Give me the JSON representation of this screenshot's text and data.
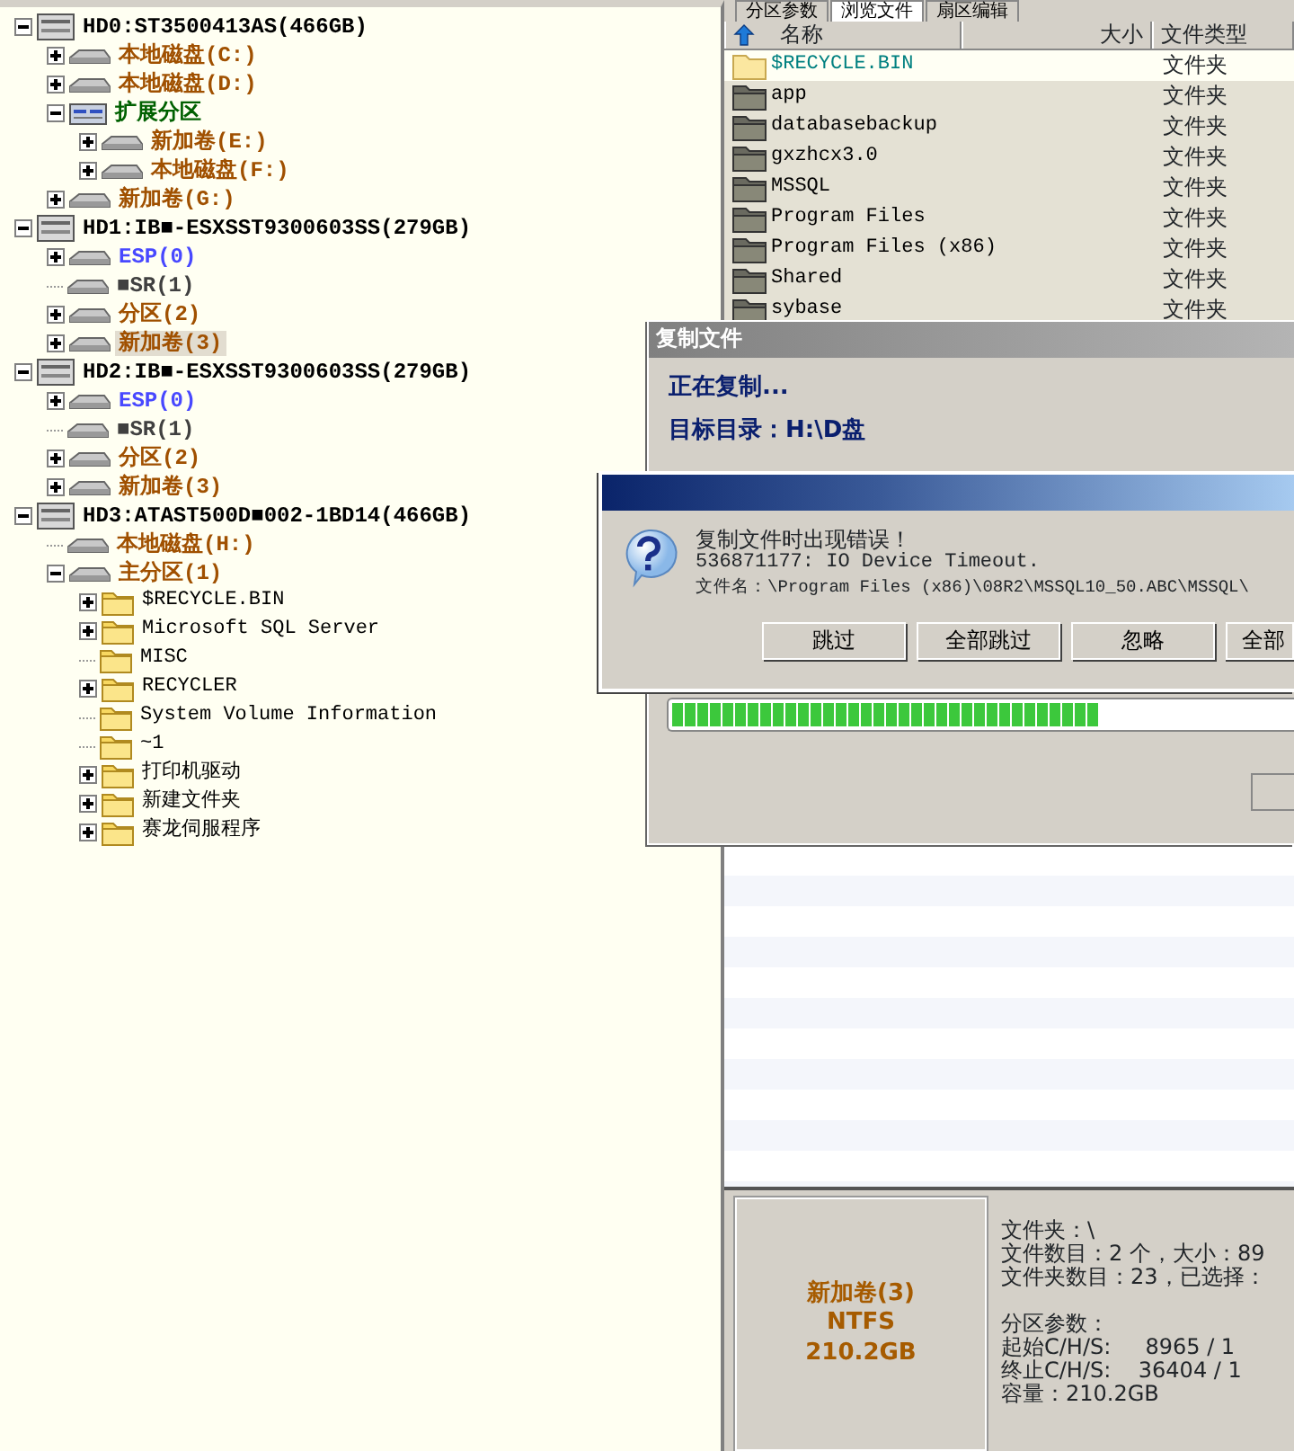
{
  "tree": [
    {
      "label": "HD0:ST3500413AS(466GB)",
      "kind": "disk",
      "expandable": true,
      "expanded": true,
      "selected": false,
      "color": "#000000",
      "children": [
        {
          "label": "本地磁盘(C:)",
          "kind": "partition",
          "expandable": true,
          "expanded": false,
          "selected": false,
          "color": "#a05000"
        },
        {
          "label": "本地磁盘(D:)",
          "kind": "partition",
          "expandable": true,
          "expanded": false,
          "selected": false,
          "color": "#a05000"
        },
        {
          "label": "扩展分区",
          "kind": "extended",
          "expandable": true,
          "expanded": true,
          "selected": false,
          "color": "#006000",
          "children": [
            {
              "label": "新加卷(E:)",
              "kind": "partition",
              "expandable": true,
              "expanded": false,
              "selected": false,
              "color": "#a05000"
            },
            {
              "label": "本地磁盘(F:)",
              "kind": "partition",
              "expandable": true,
              "expanded": false,
              "selected": false,
              "color": "#a05000"
            }
          ]
        },
        {
          "label": "新加卷(G:)",
          "kind": "partition",
          "expandable": true,
          "expanded": false,
          "selected": false,
          "color": "#a05000"
        }
      ]
    },
    {
      "label": "HD1:IB■-ESXSST9300603SS(279GB)",
      "kind": "disk",
      "expandable": true,
      "expanded": true,
      "selected": false,
      "color": "#000000",
      "children": [
        {
          "label": "ESP(0)",
          "kind": "partition",
          "expandable": true,
          "expanded": false,
          "selected": false,
          "color": "#4848ff"
        },
        {
          "label": "■SR(1)",
          "kind": "partition",
          "expandable": false,
          "selected": false,
          "color": "#404040"
        },
        {
          "label": "分区(2)",
          "kind": "partition",
          "expandable": true,
          "expanded": false,
          "selected": false,
          "color": "#a05000"
        },
        {
          "label": "新加卷(3)",
          "kind": "partition",
          "expandable": true,
          "expanded": false,
          "selected": true,
          "color": "#a05000"
        }
      ]
    },
    {
      "label": "HD2:IB■-ESXSST9300603SS(279GB)",
      "kind": "disk",
      "expandable": true,
      "expanded": true,
      "selected": false,
      "color": "#000000",
      "children": [
        {
          "label": "ESP(0)",
          "kind": "partition",
          "expandable": true,
          "expanded": false,
          "selected": false,
          "color": "#4848ff"
        },
        {
          "label": "■SR(1)",
          "kind": "partition",
          "expandable": false,
          "selected": false,
          "color": "#404040"
        },
        {
          "label": "分区(2)",
          "kind": "partition",
          "expandable": true,
          "expanded": false,
          "selected": false,
          "color": "#a05000"
        },
        {
          "label": "新加卷(3)",
          "kind": "partition",
          "expandable": true,
          "expanded": false,
          "selected": false,
          "color": "#a05000"
        }
      ]
    },
    {
      "label": "HD3:ATAST500D■002-1BD14(466GB)",
      "kind": "disk",
      "expandable": true,
      "expanded": true,
      "selected": false,
      "color": "#000000",
      "children": [
        {
          "label": "本地磁盘(H:)",
          "kind": "partition",
          "expandable": false,
          "selected": false,
          "color": "#a05000"
        },
        {
          "label": "主分区(1)",
          "kind": "partition",
          "expandable": true,
          "expanded": true,
          "selected": false,
          "color": "#a05000",
          "children": [
            {
              "label": "$RECYCLE.BIN",
              "kind": "folder",
              "expandable": true,
              "expanded": false,
              "selected": false,
              "color": "#000000"
            },
            {
              "label": "Microsoft SQL Server",
              "kind": "folder",
              "expandable": true,
              "expanded": false,
              "selected": false,
              "color": "#000000"
            },
            {
              "label": "MISC",
              "kind": "folder",
              "expandable": false,
              "selected": false,
              "color": "#000000"
            },
            {
              "label": "RECYCLER",
              "kind": "folder",
              "expandable": true,
              "expanded": false,
              "selected": false,
              "color": "#000000"
            },
            {
              "label": "System Volume Information",
              "kind": "folder",
              "expandable": false,
              "selected": false,
              "color": "#000000"
            },
            {
              "label": "~1",
              "kind": "folder",
              "expandable": false,
              "selected": false,
              "color": "#000000"
            },
            {
              "label": "打印机驱动",
              "kind": "folder",
              "expandable": true,
              "expanded": false,
              "selected": false,
              "color": "#000000"
            },
            {
              "label": "新建文件夹",
              "kind": "folder",
              "expandable": true,
              "expanded": false,
              "selected": false,
              "color": "#000000"
            },
            {
              "label": "赛龙伺服程序",
              "kind": "folder",
              "expandable": true,
              "expanded": false,
              "selected": false,
              "color": "#000000"
            }
          ]
        }
      ]
    }
  ],
  "tabs": [
    {
      "label": "分区参数",
      "selected": false
    },
    {
      "label": "浏览文件",
      "selected": true
    },
    {
      "label": "扇区编辑",
      "selected": false
    }
  ],
  "file_list": {
    "columns": [
      "名称",
      "大小",
      "文件类型"
    ],
    "rows": [
      {
        "name": "$RECYCLE.BIN",
        "type": "文件夹",
        "selected": true
      },
      {
        "name": "app",
        "type": "文件夹",
        "selected": false
      },
      {
        "name": "databasebackup",
        "type": "文件夹",
        "selected": false
      },
      {
        "name": "gxzhcx3.0",
        "type": "文件夹",
        "selected": false
      },
      {
        "name": "MSSQL",
        "type": "文件夹",
        "selected": false
      },
      {
        "name": "Program Files",
        "type": "文件夹",
        "selected": false
      },
      {
        "name": "Program Files (x86)",
        "type": "文件夹",
        "selected": false
      },
      {
        "name": "Shared",
        "type": "文件夹",
        "selected": false
      },
      {
        "name": "sybase",
        "type": "文件夹",
        "selected": false
      }
    ]
  },
  "partition_summary": {
    "name": "新加卷(3)",
    "filesystem": "NTFS",
    "capacity": "210.2GB"
  },
  "folder_info": [
    "文件夹：\\",
    "文件数目：2 个，大小：89",
    "文件夹数目：23，已选择："
  ],
  "partition_params": [
    "分区参数：",
    "起始C/H/S:     8965 / 1",
    "终止C/H/S:    36404 / 1",
    "容量：210.2GB"
  ],
  "copy_dialog": {
    "title": "复制文件",
    "status": "正在复制...",
    "target": "目标目录：H:\\D盘",
    "progress": {
      "level": 0.69
    }
  },
  "error_dialog": {
    "message": "复制文件时出现错误！",
    "error": "536871177: IO Device Timeout.",
    "file": "文件名：\\Program Files (x86)\\08R2\\MSSQL10_50.ABC\\MSSQL\\",
    "buttons": [
      "跳过",
      "全部跳过",
      "忽略",
      "全部"
    ]
  }
}
